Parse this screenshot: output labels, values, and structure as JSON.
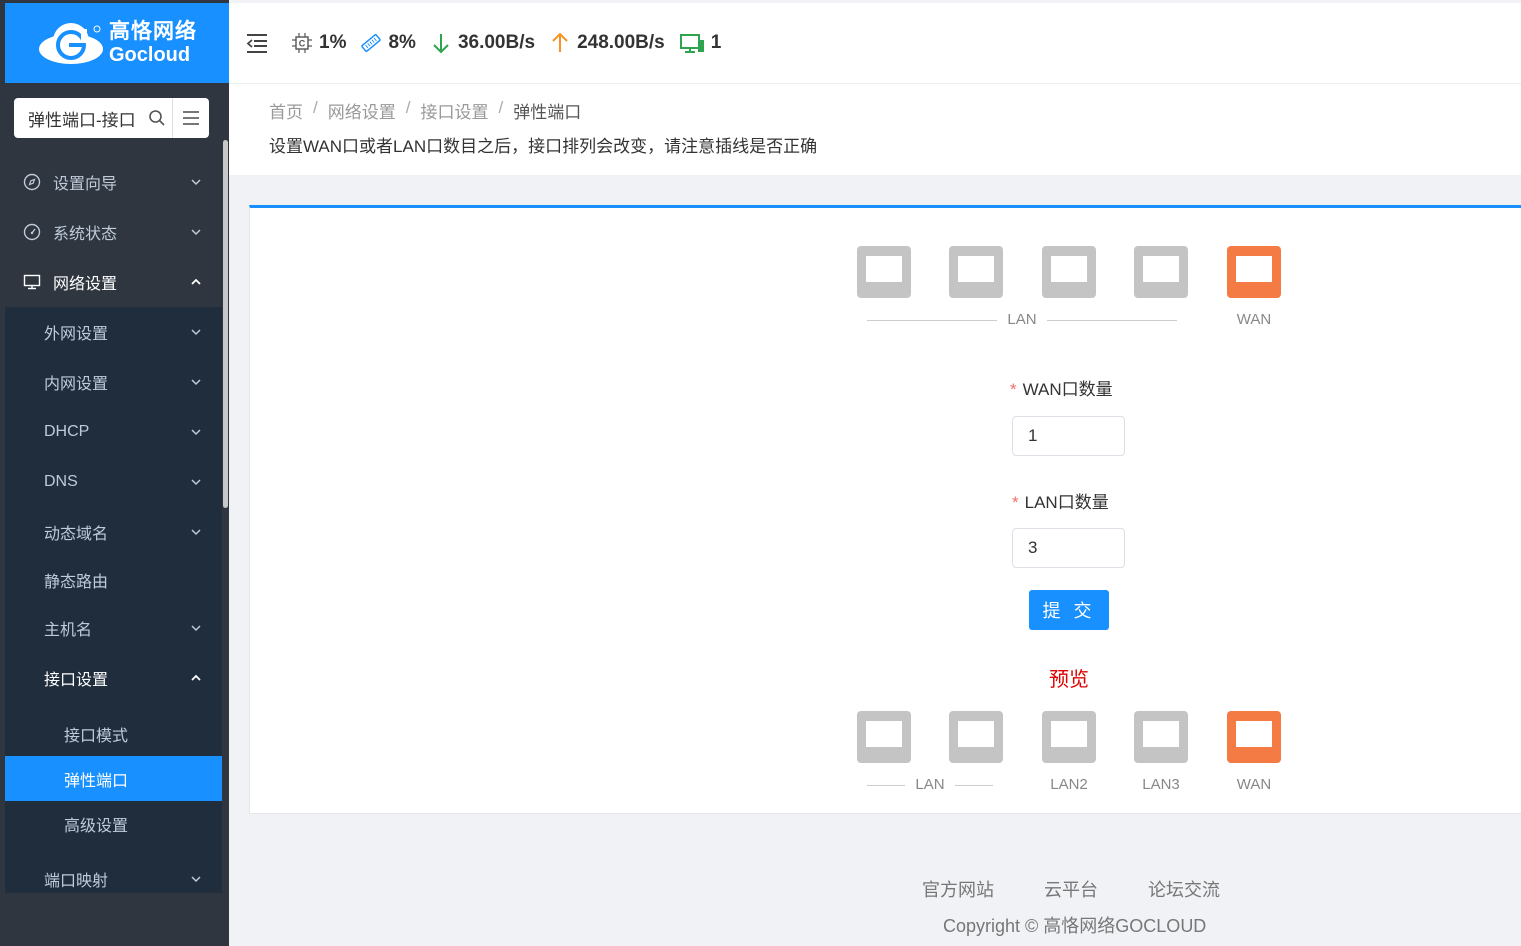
{
  "brand": {
    "name_cn": "高恪网络",
    "name_en": "Gocloud",
    "color": "#1890ff"
  },
  "sidebar": {
    "search_value": "弹性端口-接口",
    "menu": [
      {
        "label": "设置向导",
        "icon": "compass-icon"
      },
      {
        "label": "系统状态",
        "icon": "dashboard-icon"
      },
      {
        "label": "网络设置",
        "icon": "monitor-icon",
        "expanded": true
      }
    ],
    "network_sub": [
      "外网设置",
      "内网设置",
      "DHCP",
      "DNS",
      "动态域名",
      "静态路由",
      "主机名",
      "接口设置",
      "端口映射"
    ],
    "interface_sub": [
      "接口模式",
      "弹性端口",
      "高级设置"
    ]
  },
  "topbar": {
    "cpu": "1%",
    "memory": "8%",
    "download": "36.00B/s",
    "upload": "248.00B/s",
    "devices": "1"
  },
  "breadcrumb": [
    "首页",
    "网络设置",
    "接口设置",
    "弹性端口"
  ],
  "notice": "设置WAN口或者LAN口数目之后，接口排列会改变，请注意插线是否正确",
  "ports_top": {
    "lan_label": "LAN",
    "wan_label": "WAN"
  },
  "form": {
    "wan_label": "WAN口数量",
    "wan_value": "1",
    "lan_label": "LAN口数量",
    "lan_value": "3",
    "submit": "提 交"
  },
  "preview": {
    "title": "预览",
    "labels": [
      "LAN",
      "LAN2",
      "LAN3",
      "WAN"
    ]
  },
  "footer": {
    "links": [
      "官方网站",
      "云平台",
      "论坛交流"
    ],
    "copyright": "Copyright © 高恪网络GOCLOUD"
  },
  "colors": {
    "wan_port": "#f47b43",
    "lan_port": "#c4c4c4",
    "required": "#f56c6c",
    "preview": "#e00000"
  }
}
